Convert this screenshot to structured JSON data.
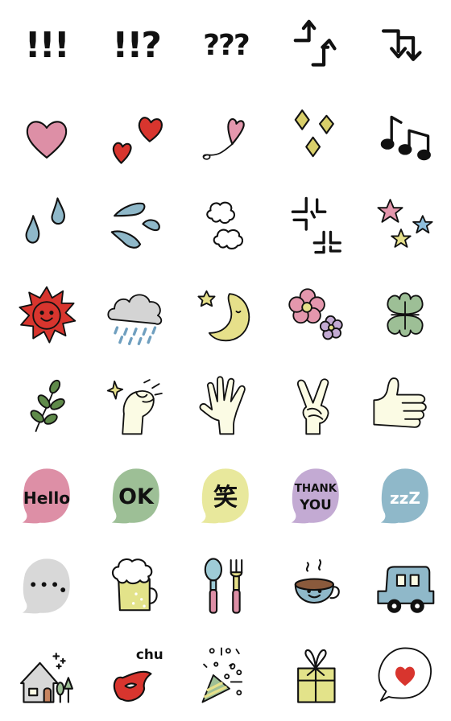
{
  "colors": {
    "pink": "#dd8fa6",
    "green": "#9dbf96",
    "yellow": "#e8e89c",
    "purple": "#c3aad3",
    "blue": "#8fb8c9",
    "gray": "#d8d8d8",
    "red": "#d8352e",
    "star_pink": "#e497ad",
    "star_blue": "#8ebfdd",
    "star_yellow": "#e6e08a"
  },
  "items": [
    {
      "icon": "triple-exclamation-icon",
      "text": "!!!"
    },
    {
      "icon": "exclamation-question-icon",
      "text": "!!?"
    },
    {
      "icon": "triple-question-icon",
      "text": "???"
    },
    {
      "icon": "up-arrows-icon"
    },
    {
      "icon": "down-arrows-icon"
    },
    {
      "icon": "pink-heart-icon"
    },
    {
      "icon": "two-red-hearts-icon"
    },
    {
      "icon": "floating-heart-icon"
    },
    {
      "icon": "sparkle-diamonds-icon"
    },
    {
      "icon": "music-notes-icon"
    },
    {
      "icon": "sweat-drops-icon"
    },
    {
      "icon": "splash-icon"
    },
    {
      "icon": "puff-clouds-icon"
    },
    {
      "icon": "anger-marks-icon"
    },
    {
      "icon": "stars-icon"
    },
    {
      "icon": "sun-icon"
    },
    {
      "icon": "rain-cloud-icon"
    },
    {
      "icon": "moon-star-icon"
    },
    {
      "icon": "flowers-icon"
    },
    {
      "icon": "four-leaf-clover-icon"
    },
    {
      "icon": "leaf-sprig-icon"
    },
    {
      "icon": "fist-icon"
    },
    {
      "icon": "open-hand-icon"
    },
    {
      "icon": "peace-sign-icon"
    },
    {
      "icon": "thumbs-up-icon"
    },
    {
      "icon": "hello-bubble-icon",
      "text": "Hello"
    },
    {
      "icon": "ok-bubble-icon",
      "text": "OK"
    },
    {
      "icon": "laugh-bubble-icon",
      "text": "笑"
    },
    {
      "icon": "thank-you-bubble-icon",
      "text": "THANK",
      "text2": "YOU"
    },
    {
      "icon": "sleep-bubble-icon",
      "text": "zzZ"
    },
    {
      "icon": "ellipsis-bubble-icon"
    },
    {
      "icon": "beer-mug-icon"
    },
    {
      "icon": "spoon-fork-icon"
    },
    {
      "icon": "coffee-cup-icon"
    },
    {
      "icon": "car-icon"
    },
    {
      "icon": "house-icon"
    },
    {
      "icon": "kiss-lips-icon",
      "text": "chu"
    },
    {
      "icon": "party-popper-icon"
    },
    {
      "icon": "gift-box-icon"
    },
    {
      "icon": "heart-bubble-icon"
    }
  ]
}
